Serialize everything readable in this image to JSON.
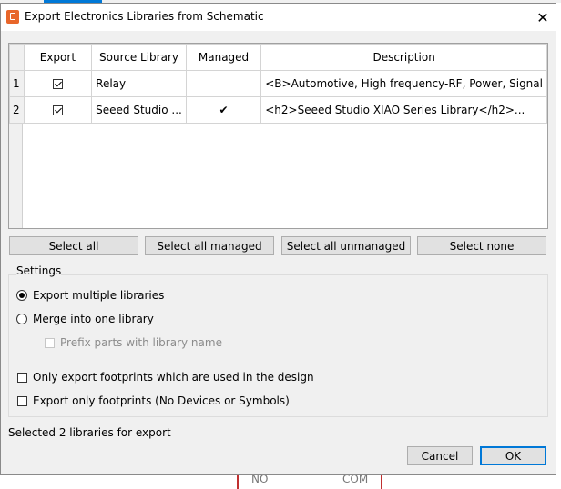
{
  "background": {
    "labels": [
      "NO",
      "COM"
    ]
  },
  "dialog": {
    "title": "Export Electronics Libraries from Schematic",
    "close_symbol": "✕"
  },
  "table": {
    "headers": [
      "Export",
      "Source Library",
      "Managed",
      "Description"
    ],
    "rows": [
      {
        "num": "1",
        "export": true,
        "source": "Relay",
        "managed": "",
        "description": "<B>Automotive, High frequency-RF, Power, Signal"
      },
      {
        "num": "2",
        "export": true,
        "source": "Seeed Studio ...",
        "managed": "✔",
        "description": "<h2>Seeed Studio XIAO Series Library</h2>..."
      }
    ]
  },
  "buttons": {
    "select_all": "Select all",
    "select_all_managed": "Select all managed",
    "select_all_unmanaged": "Select all unmanaged",
    "select_none": "Select none"
  },
  "settings": {
    "label": "Settings",
    "export_multiple": "Export multiple libraries",
    "merge_into_one": "Merge into one library",
    "prefix_parts": "Prefix parts with library name",
    "only_used_footprints": "Only export footprints which are used in the design",
    "only_footprints": "Export only footprints (No Devices or Symbols)",
    "selected_option": "export_multiple"
  },
  "status": "Selected 2 libraries for export",
  "footer": {
    "cancel": "Cancel",
    "ok": "OK"
  },
  "colors": {
    "dialog_bg": "#f0f0f0",
    "accent": "#0078d7",
    "app_icon": "#e8662a",
    "schematic_wire": "#c03030"
  }
}
